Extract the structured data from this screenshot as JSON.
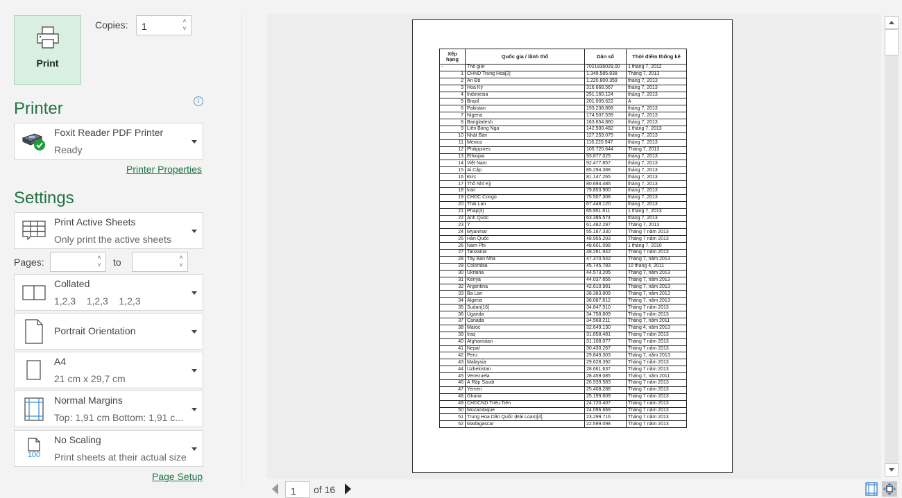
{
  "print": {
    "button_label": "Print",
    "copies_label": "Copies:",
    "copies_value": "1"
  },
  "printer": {
    "section_title": "Printer",
    "info_glyph": "i",
    "name": "Foxit Reader PDF Printer",
    "status": "Ready",
    "status_color": "#1e9e3a",
    "properties_link": "Printer Properties"
  },
  "settings": {
    "section_title": "Settings",
    "what": {
      "title": "Print Active Sheets",
      "subtitle": "Only print the active sheets"
    },
    "pages_label": "Pages:",
    "pages_from": "",
    "to_label": "to",
    "pages_to": "",
    "collation": {
      "title": "Collated",
      "subtitle": "1,2,3    1,2,3    1,2,3"
    },
    "orientation": {
      "title": "Portrait Orientation"
    },
    "paper": {
      "title": "A4",
      "subtitle": "21 cm x 29,7 cm"
    },
    "margins": {
      "title": "Normal Margins",
      "subtitle": "Top: 1,91 cm Bottom: 1,91 c..."
    },
    "scaling": {
      "title": "No Scaling",
      "subtitle": "Print sheets at their actual size",
      "icon_text": "100"
    },
    "page_setup_link": "Page Setup"
  },
  "preview": {
    "current_page": "1",
    "of_label": "of 16",
    "accent_color": "#217346",
    "sheet": {
      "headers": [
        "Xếp hạng",
        "Quốc gia / lãnh thổ",
        "Dân số",
        "Thời điểm thống kê"
      ],
      "rows": [
        [
          "-",
          "Thế giới",
          "7021836029,00",
          "1 tháng 7, 2012"
        ],
        [
          "1",
          "CHND Trung Hoa[2]",
          "1.349.585.838",
          "Tháng 7, 2013"
        ],
        [
          "2",
          "Ấn Độ",
          "1.220.800.359",
          "tháng 7, 2013"
        ],
        [
          "3",
          "Hoa Kỳ",
          "316.668.567",
          "tháng 7, 2013"
        ],
        [
          "4",
          "Indonesia",
          "251.160.124",
          "tháng 7, 2013"
        ],
        [
          "5",
          "Brazil",
          "201.009.622",
          "A"
        ],
        [
          "6",
          "Pakistan",
          "193.238.868",
          "tháng 7, 2013"
        ],
        [
          "7",
          "Nigeria",
          "174.507.539",
          "tháng 7, 2013"
        ],
        [
          "8",
          "Bangladesh",
          "163.654.860",
          "tháng 7, 2013"
        ],
        [
          "9",
          "Liên Bang Nga",
          "142.500.482",
          "1 tháng 7, 2013"
        ],
        [
          "10",
          "Nhật Bản",
          "127.253.075",
          "tháng 7, 2013"
        ],
        [
          "11",
          "Mexico",
          "116.220.947",
          "tháng 7, 2013"
        ],
        [
          "12",
          "Philippines",
          "105.720.644",
          "Tháng 7, 2013"
        ],
        [
          "13",
          "Ethiopia",
          "93.877.025",
          "tháng 7, 2013"
        ],
        [
          "14",
          "Việt Nam",
          "92.477.857",
          "tháng 7, 2013"
        ],
        [
          "15",
          "Ai Cập",
          "85.294.388",
          "tháng 7, 2013"
        ],
        [
          "16",
          "Đức",
          "81.147.265",
          "tháng 7, 2013"
        ],
        [
          "17",
          "Thổ Nhĩ Kỳ",
          "80.694.485",
          "tháng 7, 2013"
        ],
        [
          "18",
          "Iran",
          "79.853.900",
          "tháng 7, 2013"
        ],
        [
          "19",
          "CHDC Congo",
          "75.507.308",
          "tháng 7, 2013"
        ],
        [
          "20",
          "Thái Lan",
          "67.448.120",
          "tháng 7, 2013"
        ],
        [
          "21",
          "Pháp[3]",
          "65.951.611",
          "1 tháng 7, 2013"
        ],
        [
          "22",
          "Anh Quốc",
          "63.395.574",
          "tháng 7, 2013"
        ],
        [
          "23",
          "Ý",
          "61.482.297",
          "Tháng 7, 2013"
        ],
        [
          "24",
          "Myanmar",
          "55.167.330",
          "Tháng 7 năm 2013"
        ],
        [
          "25",
          "Hàn Quốc",
          "48.955.203",
          "Tháng 7 năm 2013"
        ],
        [
          "26",
          "Nam Phi",
          "48.601.098",
          "1 tháng 7, 2010"
        ],
        [
          "27",
          "Tanzania",
          "48.261.942",
          "Tháng 7 năm 2013"
        ],
        [
          "28",
          "Tây Ban Nha",
          "47.370.542",
          "Tháng 7, năm 2013"
        ],
        [
          "29",
          "Colombia",
          "45.745.783",
          "10 tháng 4, 2011"
        ],
        [
          "30",
          "Ukraina",
          "44.573.205",
          "Tháng 7, năm 2013"
        ],
        [
          "31",
          "Kenya",
          "44.037.656",
          "Tháng 7, năm 2013"
        ],
        [
          "32",
          "Argentina",
          "42.610.981",
          "Tháng 7, năm 2013"
        ],
        [
          "33",
          "Ba Lan",
          "38.383.809",
          "Tháng 7, năm 2013"
        ],
        [
          "34",
          "Algeria",
          "38.087.812",
          "Tháng 7, năm 2013"
        ],
        [
          "35",
          "Sudan[16]",
          "34.847.910",
          "Tháng 7 năm 2013"
        ],
        [
          "36",
          "Uganda",
          "34.758.809",
          "Tháng 7 năm 2013"
        ],
        [
          "37",
          "Canada",
          "34.568.211",
          "Tháng 7, năm 2011"
        ],
        [
          "38",
          "Maroc",
          "32.649.130",
          "Tháng 4, năm 2013"
        ],
        [
          "39",
          "Iraq",
          "31.858.481",
          "Tháng 7 năm 2013"
        ],
        [
          "40",
          "Afghanistan",
          "31.108.077",
          "Tháng 7 năm 2013"
        ],
        [
          "41",
          "Nepal",
          "30.430.267",
          "Tháng 7 năm 2013"
        ],
        [
          "42",
          "Peru",
          "29.849.303",
          "Tháng 7, năm 2013"
        ],
        [
          "43",
          "Malaysia",
          "29.628.392",
          "Tháng 7 năm 2013"
        ],
        [
          "44",
          "Uzbekistan",
          "28.661.637",
          "Tháng 7 năm 2013"
        ],
        [
          "45",
          "Venezuela",
          "28.459.085",
          "Tháng 7, năm 2011"
        ],
        [
          "46",
          "Ả Rập Saudi",
          "26.939.583",
          "Tháng 7 năm 2013"
        ],
        [
          "47",
          "Yemen",
          "25.408.288",
          "Tháng 7 năm 2013"
        ],
        [
          "48",
          "Ghana",
          "25.199.609",
          "Tháng 7 năm 2013"
        ],
        [
          "49",
          "CHDCND Triều Tiên",
          "24.720.407",
          "Tháng 7 năm 2013"
        ],
        [
          "50",
          "Mozambique",
          "24.096.669",
          "Tháng 7 năm 2013"
        ],
        [
          "51",
          "Trung Hoa Dân Quốc (Đài Loan)[4]",
          "23.299.716",
          "Tháng 7 năm 2013"
        ],
        [
          "52",
          "Madagascar",
          "22.599.098",
          "Tháng 7 năm 2013"
        ]
      ]
    }
  }
}
